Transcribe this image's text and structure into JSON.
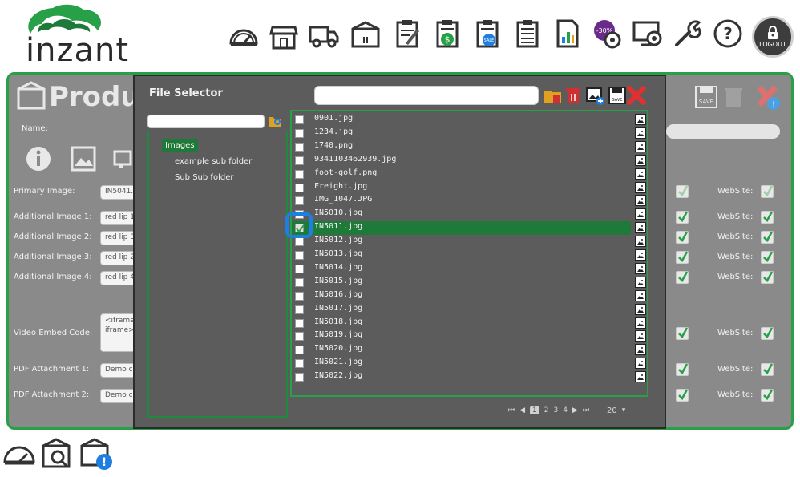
{
  "brand": {
    "logo_text": "inzant",
    "green": "#27a048",
    "dark_green": "#1e7a38",
    "focus_blue": "#1e7fe0"
  },
  "header": {
    "nav_icons": [
      "dashboard-icon",
      "storefront-icon",
      "delivery-truck-icon",
      "product-box-icon",
      "edit-document-icon",
      "sales-report-icon",
      "sale-document-icon",
      "list-document-icon",
      "chart-document-icon",
      "discount-settings-icon",
      "computer-settings-icon",
      "tools-icon",
      "help-icon"
    ],
    "logout_label": "LOGOUT"
  },
  "product_page": {
    "title": "Produ",
    "name_label": "Name:",
    "rows": [
      {
        "label": "Primary Image:",
        "value": "IN5041."
      },
      {
        "label": "Additional Image 1:",
        "value": "red lip 1"
      },
      {
        "label": "Additional Image 2:",
        "value": "red lip 3"
      },
      {
        "label": "Additional Image 3:",
        "value": "red lip 2"
      },
      {
        "label": "Additional Image 4:",
        "value": "red lip 4"
      },
      {
        "label": "Video Embed Code:",
        "value": "<iframe iframe>"
      },
      {
        "label": "PDF Attachment 1:",
        "value": "Demo ca"
      },
      {
        "label": "PDF Attachment 2:",
        "value": "Demo ca"
      }
    ],
    "website_label": "WebSite:",
    "save_label": "SAVE"
  },
  "file_selector": {
    "title": "File Selector",
    "search_value": "",
    "tree_search_value": "",
    "tree": [
      {
        "label": "Images",
        "selected": true
      },
      {
        "label": "example sub folder",
        "selected": false
      },
      {
        "label": "Sub Sub folder",
        "selected": false
      }
    ],
    "files": [
      {
        "name": "0901.jpg",
        "checked": false
      },
      {
        "name": "1234.jpg",
        "checked": false
      },
      {
        "name": "1740.png",
        "checked": false
      },
      {
        "name": "9341103462939.jpg",
        "checked": false
      },
      {
        "name": "foot-golf.png",
        "checked": false
      },
      {
        "name": "Freight.jpg",
        "checked": false
      },
      {
        "name": "IMG_1047.JPG",
        "checked": false
      },
      {
        "name": "IN5010.jpg",
        "checked": false
      },
      {
        "name": "IN5011.jpg",
        "checked": true
      },
      {
        "name": "IN5012.jpg",
        "checked": false
      },
      {
        "name": "IN5013.jpg",
        "checked": false
      },
      {
        "name": "IN5014.jpg",
        "checked": false
      },
      {
        "name": "IN5015.jpg",
        "checked": false
      },
      {
        "name": "IN5016.jpg",
        "checked": false
      },
      {
        "name": "IN5017.jpg",
        "checked": false
      },
      {
        "name": "IN5018.jpg",
        "checked": false
      },
      {
        "name": "IN5019.jpg",
        "checked": false
      },
      {
        "name": "IN5020.jpg",
        "checked": false
      },
      {
        "name": "IN5021.jpg",
        "checked": false
      },
      {
        "name": "IN5022.jpg",
        "checked": false
      }
    ],
    "pager": {
      "first": "⏮",
      "prev": "◀",
      "pages": [
        "1",
        "2",
        "3",
        "4"
      ],
      "current": "1",
      "next": "▶",
      "last": "⏭",
      "page_size": "20"
    }
  },
  "footer_icons": [
    "dashboard-icon",
    "product-search-icon",
    "product-alert-icon"
  ]
}
